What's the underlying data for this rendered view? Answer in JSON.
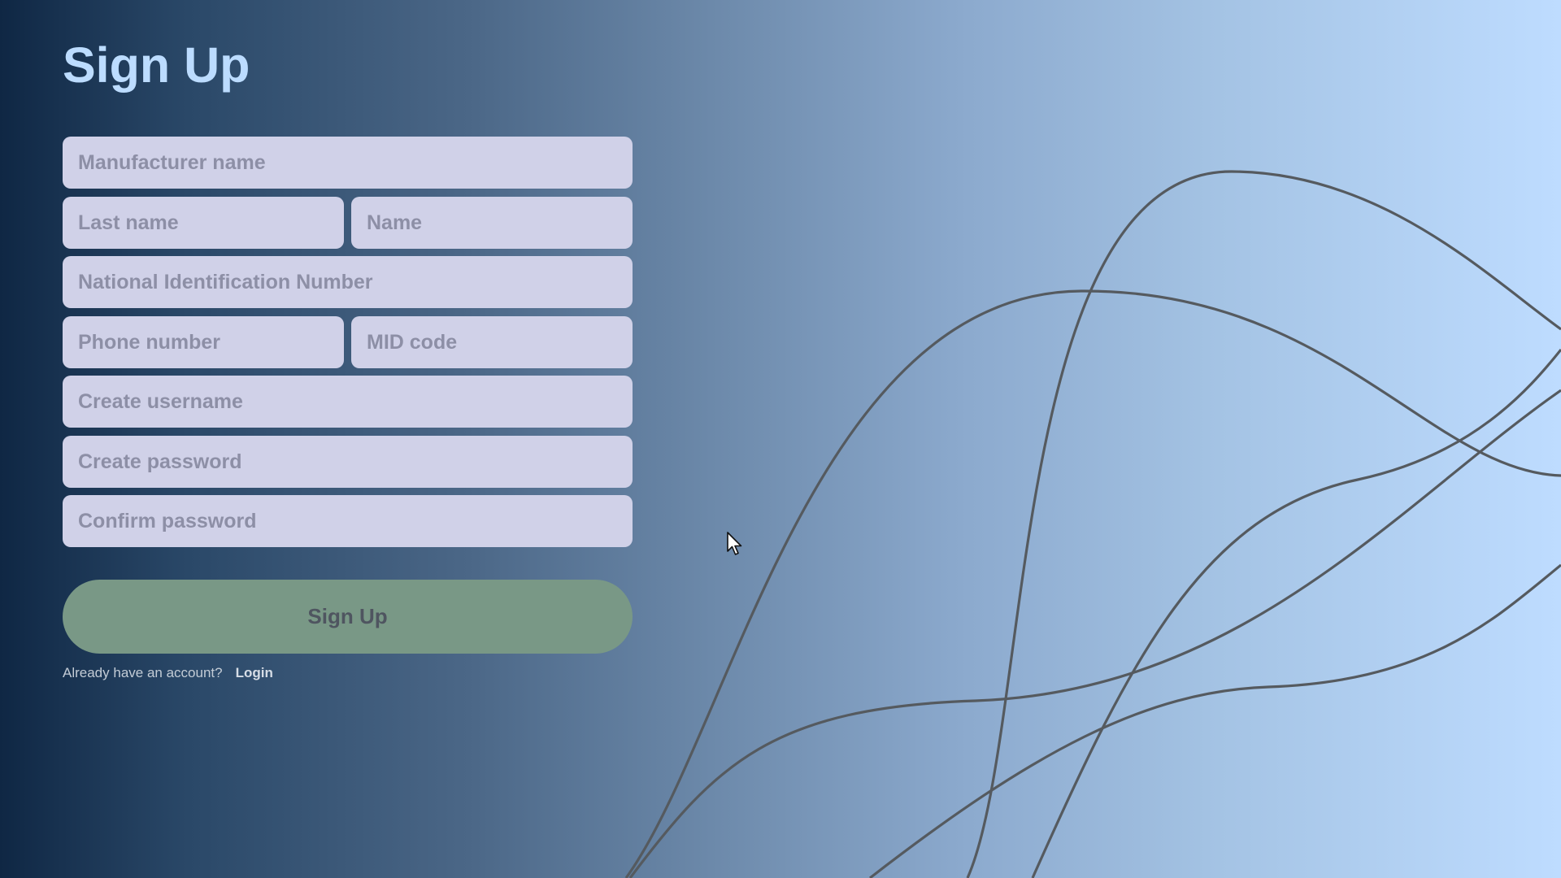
{
  "title": "Sign Up",
  "form": {
    "manufacturer_name": {
      "placeholder": "Manufacturer name",
      "value": ""
    },
    "last_name": {
      "placeholder": "Last name",
      "value": ""
    },
    "name": {
      "placeholder": "Name",
      "value": ""
    },
    "national_id": {
      "placeholder": "National Identification Number",
      "value": ""
    },
    "phone_number": {
      "placeholder": "Phone number",
      "value": ""
    },
    "mid_code": {
      "placeholder": "MID code",
      "value": ""
    },
    "username": {
      "placeholder": "Create username",
      "value": ""
    },
    "password": {
      "placeholder": "Create password",
      "value": ""
    },
    "confirm_password": {
      "placeholder": "Confirm password",
      "value": ""
    }
  },
  "submit_label": "Sign Up",
  "footer": {
    "prompt": "Already have an account?",
    "login_label": "Login"
  },
  "icons": {
    "pointer": "mouse-cursor-icon"
  },
  "colors": {
    "title": "#bcdcff",
    "field_bg": "#d0d1e8",
    "placeholder": "#8d8fa6",
    "button_bg": "#799886",
    "curve_stroke": "#555a5f"
  }
}
